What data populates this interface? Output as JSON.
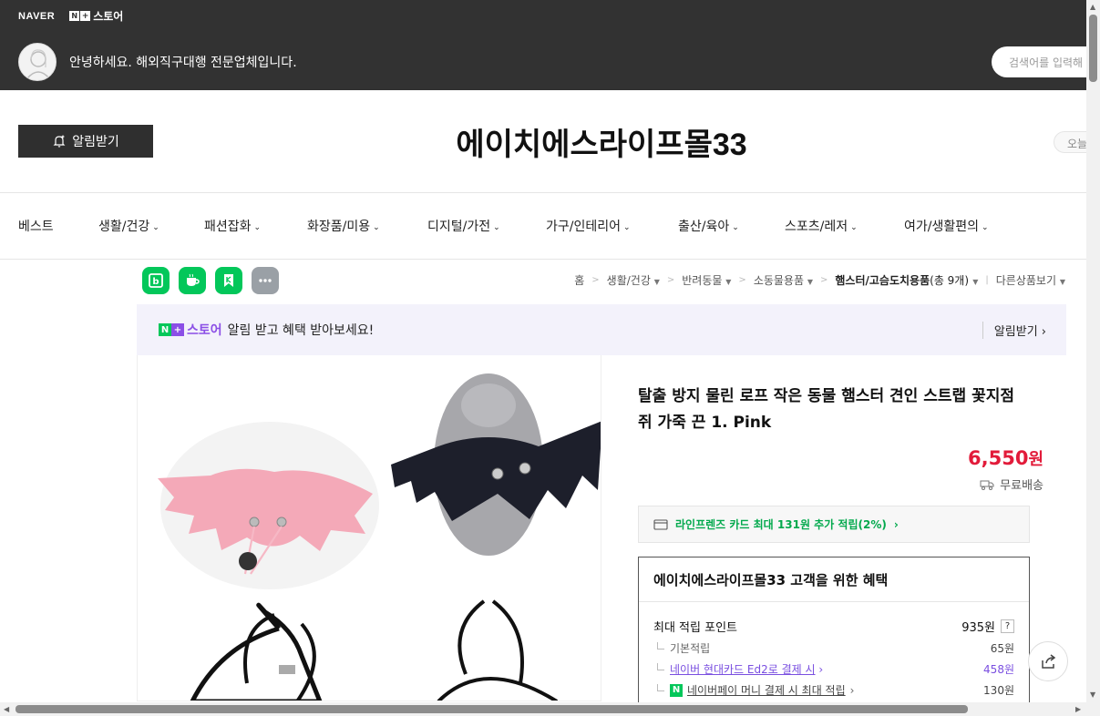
{
  "topbar": {
    "naver_logo": "NAVER",
    "store_brand": "스토어",
    "greeting": "안녕하세요. 해외직구대행 전문업체입니다.",
    "search_placeholder": "검색어를 입력해"
  },
  "header": {
    "alarm_label": "알림받기",
    "store_name": "에이치에스라이프몰33",
    "today_label": "오늘"
  },
  "nav": {
    "items": [
      {
        "label": "베스트",
        "dropdown": false
      },
      {
        "label": "생활/건강",
        "dropdown": true
      },
      {
        "label": "패션잡화",
        "dropdown": true
      },
      {
        "label": "화장품/미용",
        "dropdown": true
      },
      {
        "label": "디지털/가전",
        "dropdown": true
      },
      {
        "label": "가구/인테리어",
        "dropdown": true
      },
      {
        "label": "출산/육아",
        "dropdown": true
      },
      {
        "label": "스포츠/레저",
        "dropdown": true
      },
      {
        "label": "여가/생활편의",
        "dropdown": true
      }
    ]
  },
  "breadcrumb": {
    "home": "홈",
    "c1": "생활/건강",
    "c2": "반려동물",
    "c3": "소동물용품",
    "current": "햄스터/고슴도치용품",
    "count": "(총 9개)",
    "other": "다른상품보기"
  },
  "promo": {
    "logo_text": "스토어",
    "text": "알림 받고 혜택 받아보세요!",
    "action": "알림받기"
  },
  "product": {
    "title": "탈출 방지 물린 로프 작은 동물 햄스터 견인 스트랩 꽃지점 쥐 가죽 끈 1. Pink",
    "price": "6,550",
    "price_unit": "원",
    "shipping": "무료배송",
    "card_benefit": "라인프렌즈 카드 최대 131원 추가 적립(2%)"
  },
  "benefits": {
    "title": "에이치에스라이프몰33 고객을 위한 혜택",
    "max_points_label": "최대 적립 포인트",
    "max_points_value": "935원",
    "qmark": "?",
    "rows": [
      {
        "label": "기본적립",
        "value": "65원"
      },
      {
        "label": "네이버 현대카드 Ed2로 결제 시",
        "value": "458원"
      },
      {
        "label": "네이버페이 머니 결제 시 최대 적립",
        "value": "130원"
      }
    ]
  },
  "colors": {
    "topbar_bg": "#323232",
    "price_red": "#e21b3a",
    "naver_green": "#03c75a",
    "purple": "#8b4fe6"
  }
}
